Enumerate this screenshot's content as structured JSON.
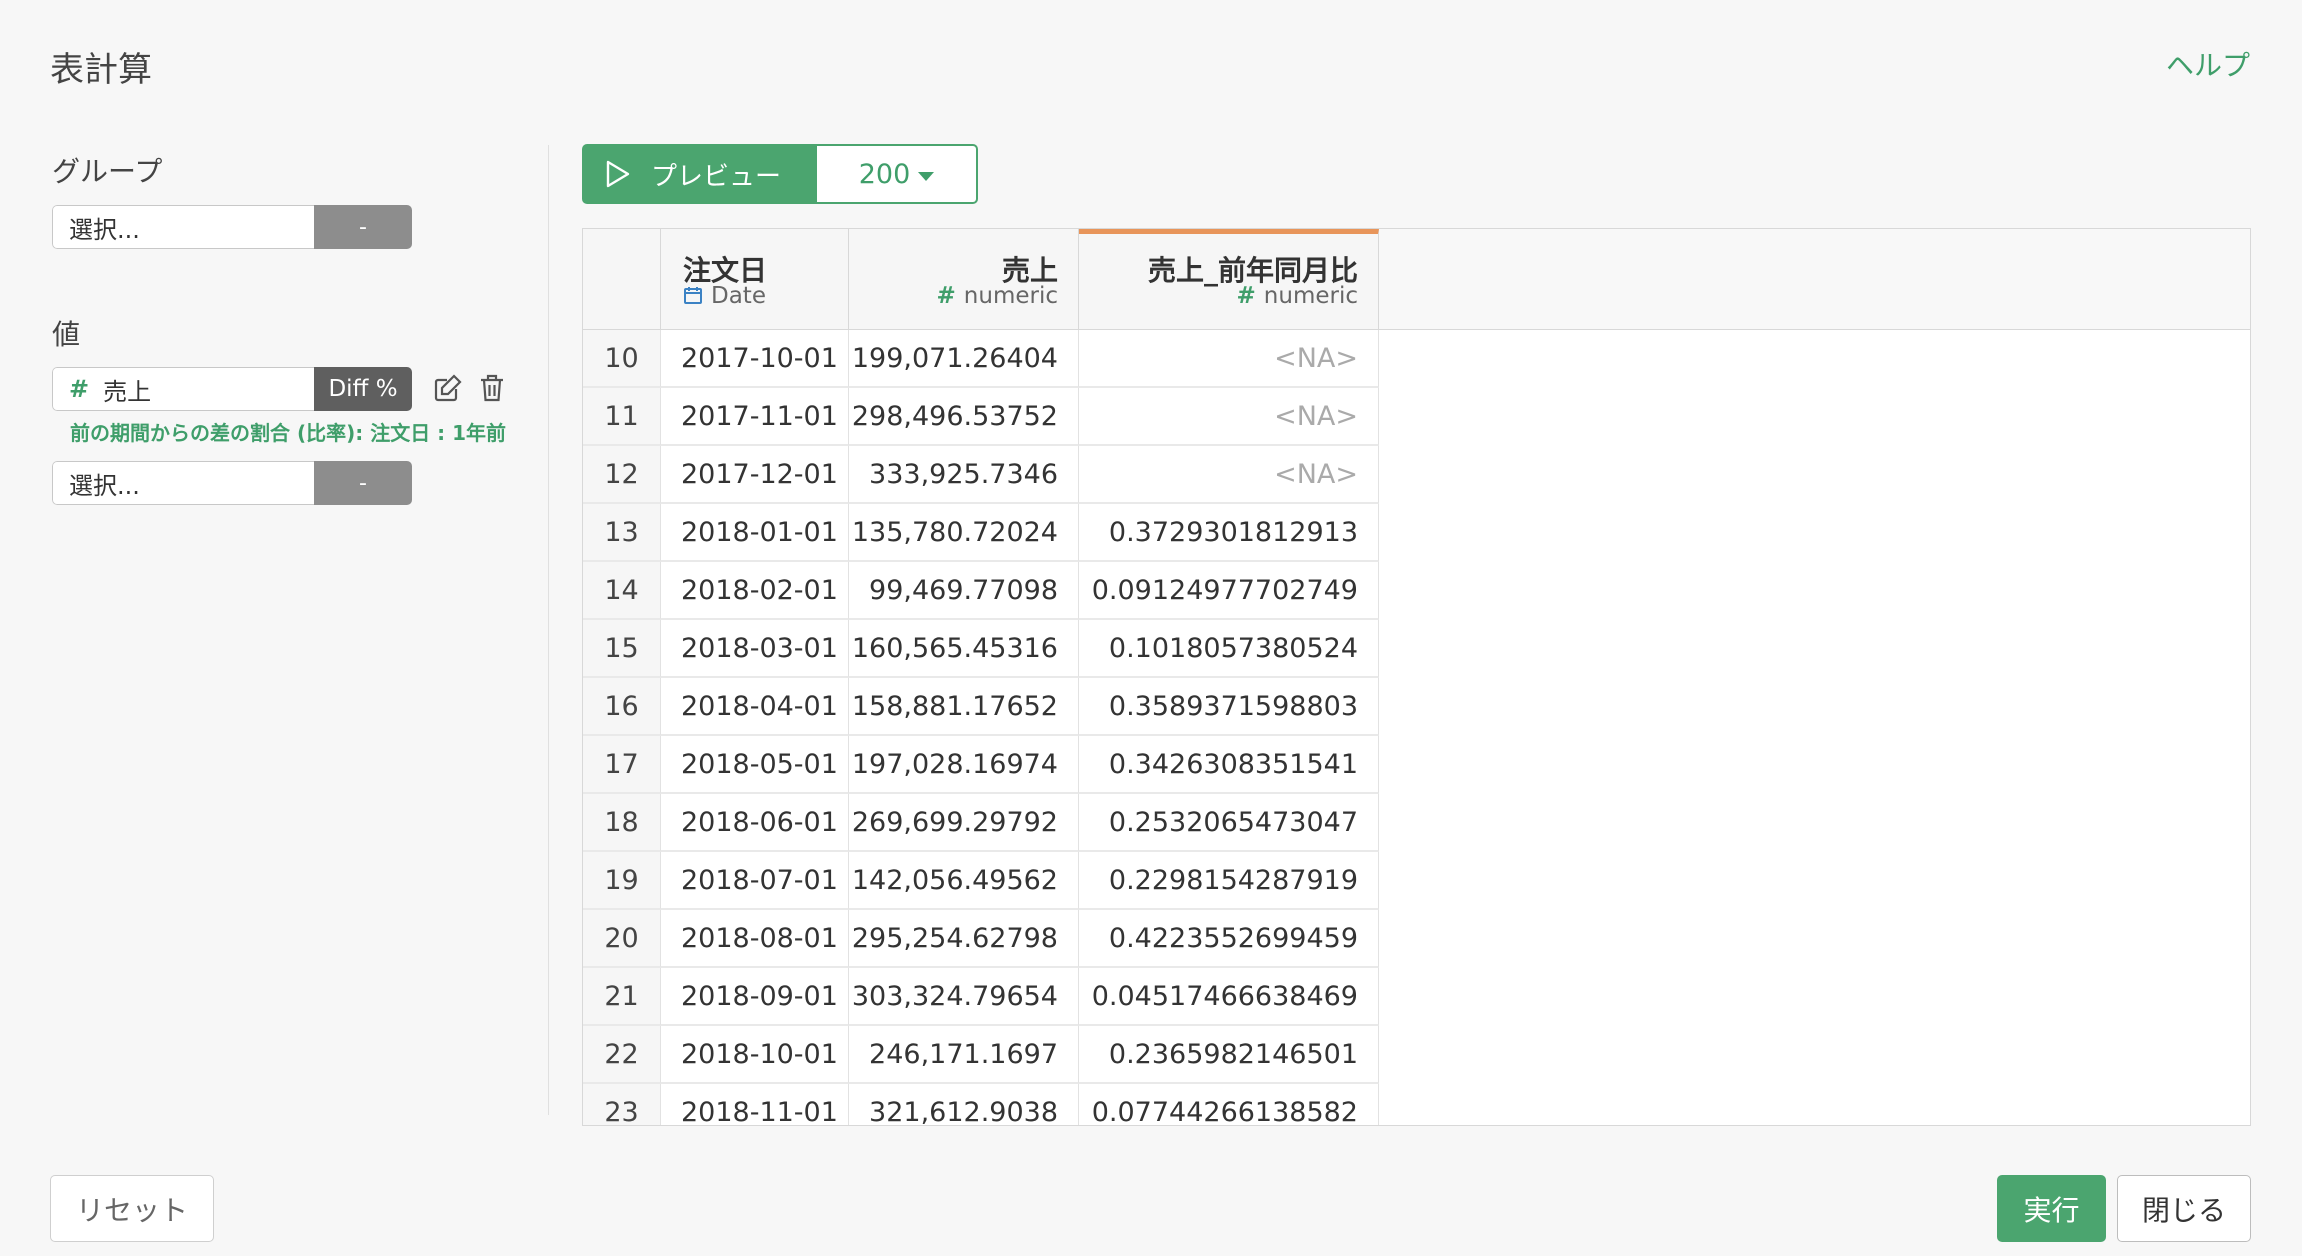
{
  "header": {
    "title": "表計算",
    "help_label": "ヘルプ"
  },
  "group_section": {
    "label": "グループ",
    "select_placeholder": "選択...",
    "remove_label": "-"
  },
  "value_section": {
    "label": "値",
    "value_hash": "#",
    "value_name": "売上",
    "value_calc": "Diff %",
    "description": "前の期間からの差の割合 (比率): 注文日 : 1年前",
    "select_placeholder": "選択...",
    "remove_label": "-",
    "edit_icon": "edit-icon",
    "delete_icon": "trash-icon"
  },
  "toolbar": {
    "preview_label": "プレビュー",
    "preview_icon": "play-icon",
    "row_count": "200"
  },
  "table": {
    "columns": [
      {
        "name": "注文日",
        "type": "Date",
        "type_icon": "calendar-icon"
      },
      {
        "name": "売上",
        "type": "numeric",
        "type_icon": "#"
      },
      {
        "name": "売上_前年同月比",
        "type": "numeric",
        "type_icon": "#"
      }
    ],
    "rows": [
      {
        "n": "10",
        "date": "2017-10-01",
        "sales": "199,071.26404",
        "ratio": "<NA>"
      },
      {
        "n": "11",
        "date": "2017-11-01",
        "sales": "298,496.53752",
        "ratio": "<NA>"
      },
      {
        "n": "12",
        "date": "2017-12-01",
        "sales": "333,925.7346",
        "ratio": "<NA>"
      },
      {
        "n": "13",
        "date": "2018-01-01",
        "sales": "135,780.72024",
        "ratio": "0.3729301812913"
      },
      {
        "n": "14",
        "date": "2018-02-01",
        "sales": "99,469.77098",
        "ratio": "0.09124977702749"
      },
      {
        "n": "15",
        "date": "2018-03-01",
        "sales": "160,565.45316",
        "ratio": "0.1018057380524"
      },
      {
        "n": "16",
        "date": "2018-04-01",
        "sales": "158,881.17652",
        "ratio": "0.3589371598803"
      },
      {
        "n": "17",
        "date": "2018-05-01",
        "sales": "197,028.16974",
        "ratio": "0.3426308351541"
      },
      {
        "n": "18",
        "date": "2018-06-01",
        "sales": "269,699.29792",
        "ratio": "0.2532065473047"
      },
      {
        "n": "19",
        "date": "2018-07-01",
        "sales": "142,056.49562",
        "ratio": "0.2298154287919"
      },
      {
        "n": "20",
        "date": "2018-08-01",
        "sales": "295,254.62798",
        "ratio": "0.4223552699459"
      },
      {
        "n": "21",
        "date": "2018-09-01",
        "sales": "303,324.79654",
        "ratio": "0.04517466638469"
      },
      {
        "n": "22",
        "date": "2018-10-01",
        "sales": "246,171.1697",
        "ratio": "0.2365982146501"
      },
      {
        "n": "23",
        "date": "2018-11-01",
        "sales": "321,612.9038",
        "ratio": "0.07744266138582"
      }
    ]
  },
  "footer": {
    "reset_label": "リセット",
    "run_label": "実行",
    "close_label": "閉じる"
  },
  "colors": {
    "accent": "#4ba56f",
    "active_column": "#e8955a",
    "dark_button": "#5f5f5f",
    "gray_button": "#8d8d8d"
  }
}
